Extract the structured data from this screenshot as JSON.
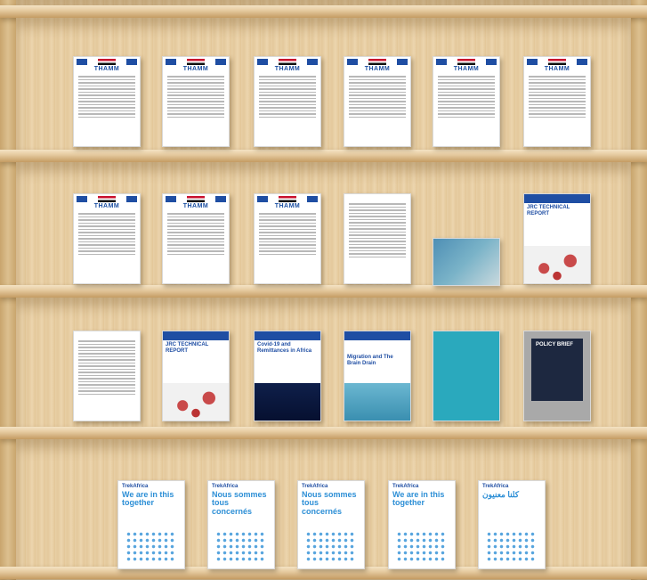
{
  "shelves": [
    {
      "books": [
        {
          "label": "THAMM",
          "type": "thamm"
        },
        {
          "label": "THAMM",
          "type": "thamm"
        },
        {
          "label": "THAMM",
          "type": "thamm"
        },
        {
          "label": "THAMM",
          "type": "thamm"
        },
        {
          "label": "THAMM",
          "type": "thamm"
        },
        {
          "label": "THAMM",
          "type": "thamm"
        }
      ]
    },
    {
      "books": [
        {
          "label": "THAMM",
          "type": "thamm"
        },
        {
          "label": "THAMM",
          "type": "thamm"
        },
        {
          "label": "THAMM",
          "type": "thamm"
        },
        {
          "label": "",
          "type": "plain"
        },
        {
          "label": "",
          "type": "photo"
        },
        {
          "label": "JRC TECHNICAL REPORT",
          "type": "virus"
        }
      ]
    },
    {
      "books": [
        {
          "label": "",
          "type": "plain"
        },
        {
          "label": "JRC TECHNICAL REPORT",
          "type": "virus"
        },
        {
          "label": "Covid-19 and Remittances in Africa",
          "type": "darkblue"
        },
        {
          "label": "Migration and The Brain Drain",
          "type": "brain"
        },
        {
          "label": "",
          "type": "teal"
        },
        {
          "label": "POLICY BRIEF",
          "type": "policy"
        }
      ]
    },
    {
      "books": [
        {
          "label": "We are in this together",
          "brand": "TrekAfrica",
          "type": "trek"
        },
        {
          "label": "Nous sommes tous concernés",
          "brand": "TrekAfrica",
          "type": "trek"
        },
        {
          "label": "Nous sommes tous concernés",
          "brand": "TrekAfrica",
          "type": "trek"
        },
        {
          "label": "We are in this together",
          "brand": "TrekAfrica",
          "type": "trek"
        },
        {
          "label": "كلنا معنيون",
          "brand": "TrekAfrica",
          "type": "trek"
        }
      ]
    }
  ]
}
